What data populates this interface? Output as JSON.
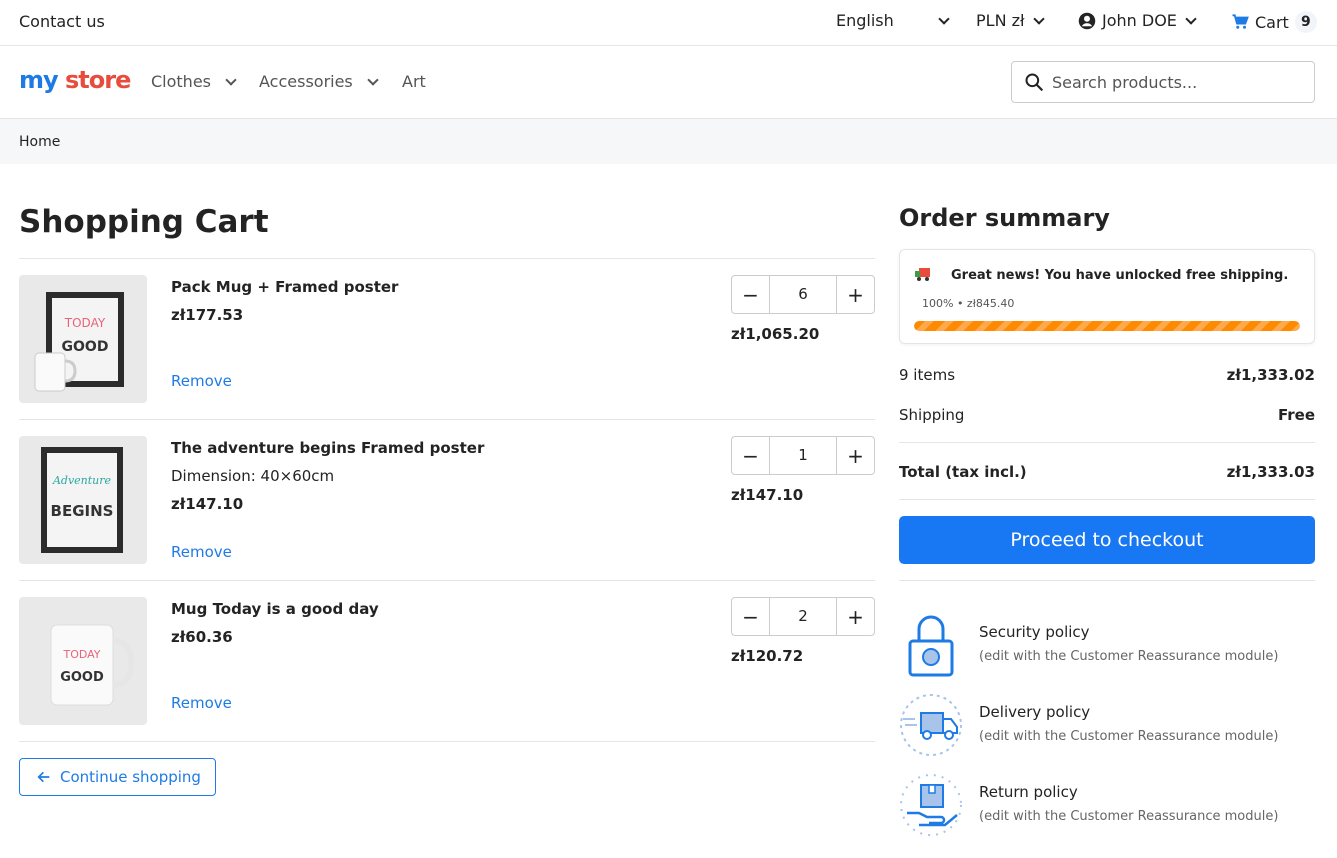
{
  "topbar": {
    "contact": "Contact us",
    "language": "English",
    "currency": "PLN zł",
    "user": "John DOE",
    "cart_label": "Cart",
    "cart_count": "9"
  },
  "header": {
    "logo_my": "my",
    "logo_store": "store",
    "nav": [
      "Clothes",
      "Accessories",
      "Art"
    ],
    "search_placeholder": "Search products..."
  },
  "breadcrumb": {
    "home": "Home"
  },
  "cart": {
    "title": "Shopping Cart",
    "items": [
      {
        "name": "Pack Mug + Framed poster",
        "attr": "",
        "price": "zł177.53",
        "qty": "6",
        "total": "zł1,065.20",
        "remove": "Remove"
      },
      {
        "name": "The adventure begins Framed poster",
        "attr": "Dimension: 40×60cm",
        "price": "zł147.10",
        "qty": "1",
        "total": "zł147.10",
        "remove": "Remove"
      },
      {
        "name": "Mug Today is a good day",
        "attr": "",
        "price": "zł60.36",
        "qty": "2",
        "total": "zł120.72",
        "remove": "Remove"
      }
    ],
    "continue": "Continue shopping"
  },
  "summary": {
    "title": "Order summary",
    "free_shipping_msg": "Great news! You have unlocked free shipping.",
    "progress_text": "100% • zł845.40",
    "progress_fraction": 1.0,
    "items_label": "9 items",
    "items_value": "zł1,333.02",
    "shipping_label": "Shipping",
    "shipping_value": "Free",
    "total_label": "Total (tax incl.)",
    "total_value": "zł1,333.03",
    "checkout": "Proceed to checkout",
    "reassurance": [
      {
        "title": "Security policy",
        "sub": "(edit with the Customer Reassurance module)",
        "icon": "lock-icon"
      },
      {
        "title": "Delivery policy",
        "sub": "(edit with the Customer Reassurance module)",
        "icon": "delivery-truck-icon"
      },
      {
        "title": "Return policy",
        "sub": "(edit with the Customer Reassurance module)",
        "icon": "return-box-hand-icon"
      }
    ]
  },
  "colors": {
    "accent": "#1877f2",
    "link": "#1e7be5",
    "progress": "#ff8a00"
  }
}
